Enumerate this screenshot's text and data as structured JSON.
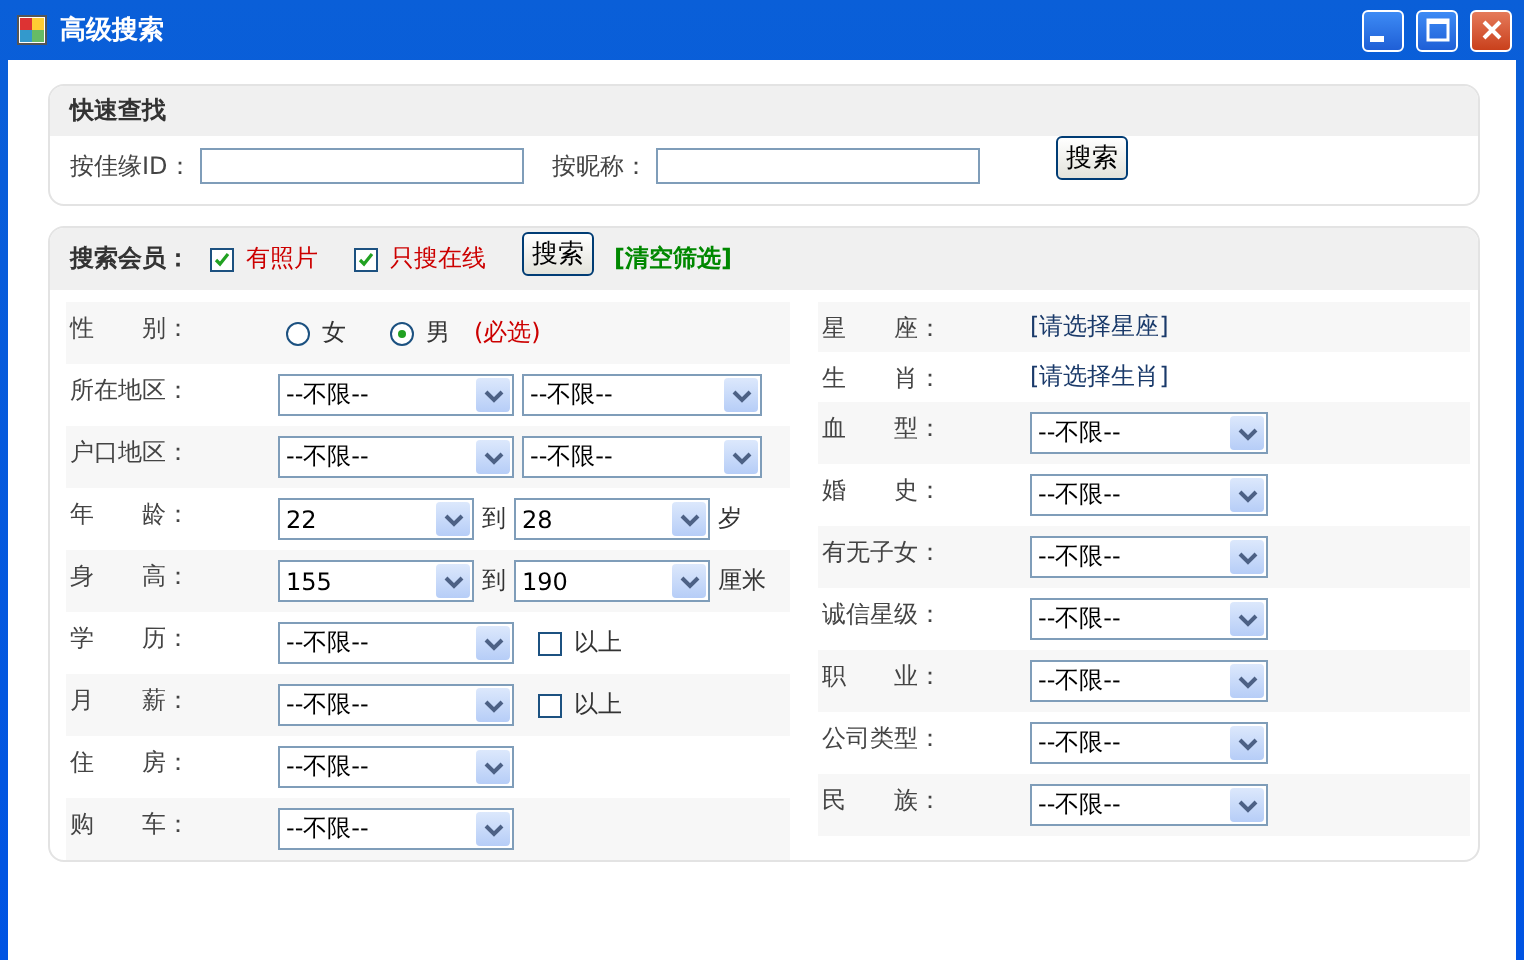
{
  "window": {
    "title": "高级搜索"
  },
  "quick_search": {
    "title": "快速查找",
    "fields": [
      {
        "label": "按佳缘ID："
      },
      {
        "label": "按昵称："
      }
    ],
    "button": "搜索"
  },
  "search_members": {
    "title": "搜索会员：",
    "options": [
      {
        "label": "有照片",
        "checked": true
      },
      {
        "label": "只搜在线",
        "checked": true
      }
    ],
    "button": "搜索",
    "clear_link": "[清空筛选]",
    "left_rows": [
      {
        "kind": "radio",
        "label": "性　　别：",
        "options": [
          {
            "label": "女",
            "selected": false
          },
          {
            "label": "男",
            "selected": true
          }
        ],
        "note": "(必选)"
      },
      {
        "kind": "pair",
        "label": "所在地区：",
        "selects": [
          "--不限--",
          "--不限--"
        ]
      },
      {
        "kind": "pair",
        "label": "户口地区：",
        "selects": [
          "--不限--",
          "--不限--"
        ]
      },
      {
        "kind": "range",
        "label": "年　　龄：",
        "selects": [
          "22",
          "28"
        ],
        "separator": "到",
        "unit": "岁"
      },
      {
        "kind": "range",
        "label": "身　　高：",
        "selects": [
          "155",
          "190"
        ],
        "separator": "到",
        "unit": "厘米"
      },
      {
        "kind": "select",
        "label": "学　　历：",
        "value": "--不限--",
        "checkbox": {
          "label": "以上",
          "checked": false
        }
      },
      {
        "kind": "select",
        "label": "月　　薪：",
        "value": "--不限--",
        "checkbox": {
          "label": "以上",
          "checked": false
        }
      },
      {
        "kind": "select",
        "label": "住　　房：",
        "value": "--不限--"
      },
      {
        "kind": "select",
        "label": "购　　车：",
        "value": "--不限--"
      }
    ],
    "right_rows": [
      {
        "kind": "link",
        "label": "星　　座：",
        "link": "[请选择星座]"
      },
      {
        "kind": "link",
        "label": "生　　肖：",
        "link": "[请选择生肖]"
      },
      {
        "kind": "select",
        "label": "血　　型：",
        "value": "--不限--"
      },
      {
        "kind": "select",
        "label": "婚　　史：",
        "value": "--不限--"
      },
      {
        "kind": "select",
        "label": "有无子女：",
        "value": "--不限--"
      },
      {
        "kind": "select",
        "label": "诚信星级：",
        "value": "--不限--"
      },
      {
        "kind": "select",
        "label": "职　　业：",
        "value": "--不限--"
      },
      {
        "kind": "select",
        "label": "公司类型：",
        "value": "--不限--"
      },
      {
        "kind": "select",
        "label": "民　　族：",
        "value": "--不限--"
      }
    ]
  }
}
